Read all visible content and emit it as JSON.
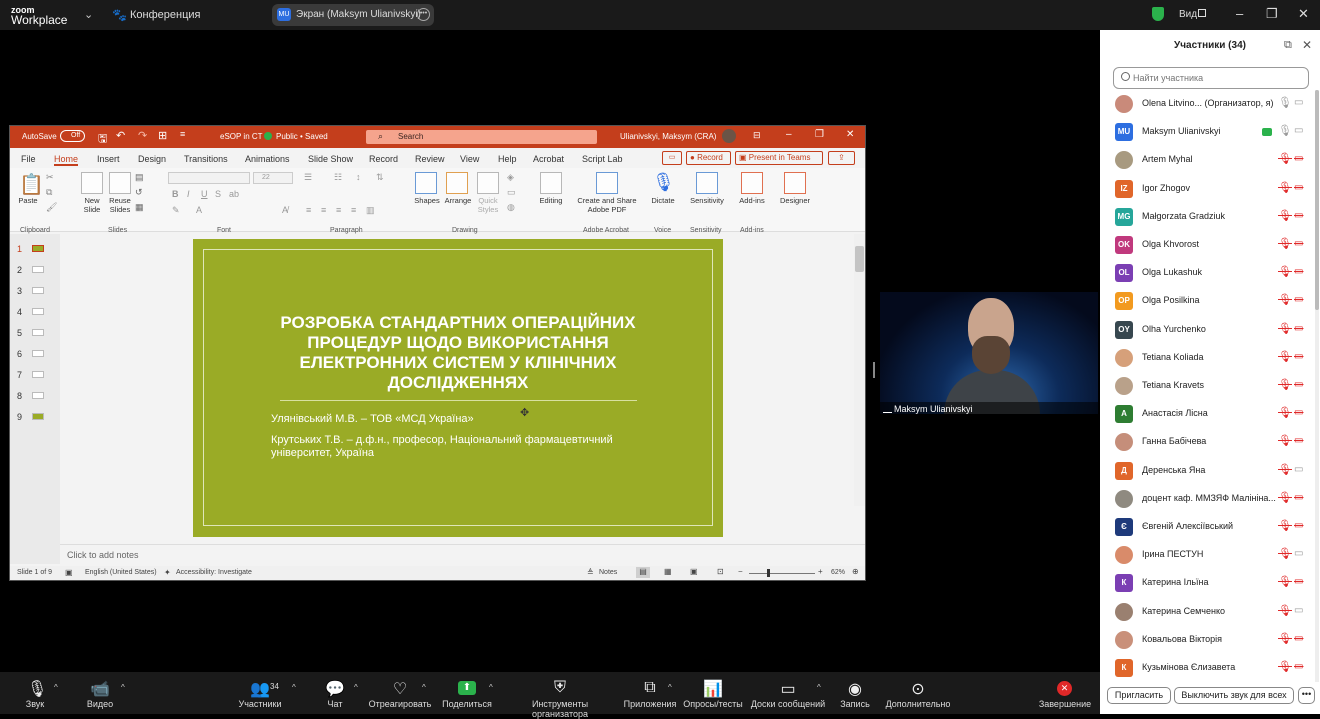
{
  "topbar": {
    "logo_line1": "zoom",
    "logo_line2": "Workplace",
    "conference_label": "Конференция",
    "share_badge": "MU",
    "share_label": "Экран (Maksym Ulianivskyi)",
    "view_label": "Вид",
    "minimize": "–",
    "maximize": "❐",
    "close": "✕"
  },
  "ppt": {
    "autosave": "AutoSave",
    "autosave_state": "Off",
    "filename": "eSOP in CT",
    "filestatus": "Public • Saved",
    "search_placeholder": "Search",
    "user": "Ulianivskyi, Maksym (CRA)",
    "menu": [
      "File",
      "Home",
      "Insert",
      "Design",
      "Transitions",
      "Animations",
      "Slide Show",
      "Record",
      "Review",
      "View",
      "Help",
      "Acrobat",
      "Script Lab"
    ],
    "record_btn": "Record",
    "teams_btn": "Present in Teams",
    "ribbon_groups": [
      "Clipboard",
      "Slides",
      "Font",
      "Paragraph",
      "Drawing",
      "Adobe Acrobat",
      "Voice",
      "Sensitivity",
      "Add-ins"
    ],
    "ribbon_labels": {
      "paste": "Paste",
      "new_slide": "New Slide",
      "reuse_slides": "Reuse Slides",
      "font_size": "22",
      "shapes": "Shapes",
      "arrange": "Arrange",
      "quick_styles": "Quick Styles",
      "editing": "Editing",
      "create_pdf": "Create and Share Adobe PDF",
      "dictate": "Dictate",
      "sensitivity": "Sensitivity",
      "addins": "Add-ins",
      "designer": "Designer"
    },
    "thumbnails": [
      "1",
      "2",
      "3",
      "4",
      "5",
      "6",
      "7",
      "8",
      "9"
    ],
    "slide": {
      "title": "РОЗРОБКА СТАНДАРТНИХ ОПЕРАЦІЙНИХ ПРОЦЕДУР ЩОДО ВИКОРИСТАННЯ ЕЛЕКТРОННИХ СИСТЕМ У КЛІНІЧНИХ ДОСЛІДЖЕННЯХ",
      "author1": "Улянівський М.В. – ТОВ «МСД Україна»",
      "author2": "Крутських Т.В. – д.ф.н., професор, Національний фармацевтичний університет, Україна"
    },
    "notes_placeholder": "Click to add notes",
    "status": {
      "slide_count": "Slide 1 of 9",
      "language": "English (United States)",
      "accessibility": "Accessibility: Investigate",
      "notes": "Notes",
      "zoom": "62%"
    }
  },
  "video": {
    "name": "Maksym Ulianivskyi"
  },
  "panel": {
    "title": "Участники (34)",
    "search_placeholder": "Найти участника",
    "participants": [
      {
        "name": "Olena Litvino... (Организатор, я)",
        "initials": "",
        "color": "#c98a7a",
        "mic": "on",
        "cam": "off"
      },
      {
        "name": "Maksym Ulianivskyi",
        "initials": "MU",
        "color": "#2d6ee0",
        "mic": "on",
        "cam": "off",
        "sharing": true
      },
      {
        "name": "Artem Myhal",
        "initials": "",
        "color": "#a89a80",
        "mic": "muted",
        "cam": "muted"
      },
      {
        "name": "Igor Zhogov",
        "initials": "IZ",
        "color": "#e0662a",
        "mic": "muted",
        "cam": "muted"
      },
      {
        "name": "Małgorzata Gradziuk",
        "initials": "MG",
        "color": "#26a69a",
        "mic": "muted",
        "cam": "muted"
      },
      {
        "name": "Olga Khvorost",
        "initials": "OK",
        "color": "#c0397d",
        "mic": "muted",
        "cam": "muted"
      },
      {
        "name": "Olga Lukashuk",
        "initials": "OL",
        "color": "#7b3fb3",
        "mic": "muted",
        "cam": "muted"
      },
      {
        "name": "Olga Posilkina",
        "initials": "OP",
        "color": "#f29a1f",
        "mic": "muted",
        "cam": "muted"
      },
      {
        "name": "Olha Yurchenko",
        "initials": "OY",
        "color": "#37474f",
        "mic": "muted",
        "cam": "muted"
      },
      {
        "name": "Tetiana Koliada",
        "initials": "",
        "color": "#d6a07a",
        "mic": "muted",
        "cam": "muted"
      },
      {
        "name": "Tetiana Kravets",
        "initials": "",
        "color": "#b9a18a",
        "mic": "muted",
        "cam": "muted"
      },
      {
        "name": "Анастасія Лісна",
        "initials": "А",
        "color": "#2e7d32",
        "mic": "muted",
        "cam": "muted"
      },
      {
        "name": "Ганна Бабічева",
        "initials": "",
        "color": "#c58e7a",
        "mic": "muted",
        "cam": "muted"
      },
      {
        "name": "Деренська Яна",
        "initials": "Д",
        "color": "#e0662a",
        "mic": "muted",
        "cam": "off"
      },
      {
        "name": "доцент каф. ММЗЯФ Малініна...",
        "initials": "",
        "color": "#8f8a80",
        "mic": "muted",
        "cam": "muted"
      },
      {
        "name": "Євгеній Алексіївський",
        "initials": "Є",
        "color": "#1e3a7b",
        "mic": "muted",
        "cam": "muted"
      },
      {
        "name": "Ірина ПЕСТУН",
        "initials": "",
        "color": "#d98b6a",
        "mic": "muted",
        "cam": "off"
      },
      {
        "name": "Катерина Ільїна",
        "initials": "К",
        "color": "#7b3fb3",
        "mic": "muted",
        "cam": "muted"
      },
      {
        "name": "Катерина Семченко",
        "initials": "",
        "color": "#9a8070",
        "mic": "muted",
        "cam": "off"
      },
      {
        "name": "Ковальова Вікторія",
        "initials": "",
        "color": "#c9907a",
        "mic": "muted",
        "cam": "muted"
      },
      {
        "name": "Кузьмінова Єлизавета",
        "initials": "К",
        "color": "#e0662a",
        "mic": "muted",
        "cam": "muted"
      }
    ],
    "invite": "Пригласить",
    "mute_all": "Выключить звук для всех",
    "more": "•••"
  },
  "toolbar": {
    "audio": "Звук",
    "video": "Видео",
    "participants": "Участники",
    "participants_count": "34",
    "chat": "Чат",
    "react": "Отреагировать",
    "share": "Поделиться",
    "host_tools": "Инструменты организатора",
    "apps": "Приложения",
    "polls": "Опросы/тесты",
    "whiteboards": "Доски сообщений",
    "record": "Запись",
    "more": "Дополнительно",
    "end": "Завершение"
  }
}
